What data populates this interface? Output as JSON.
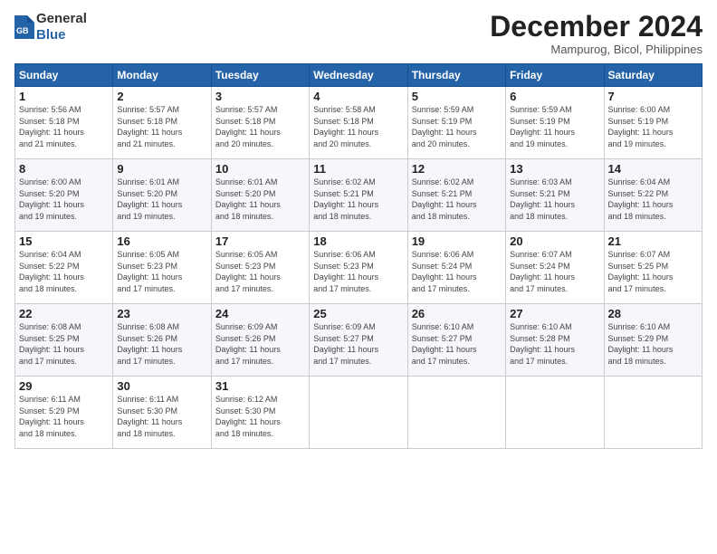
{
  "header": {
    "logo": {
      "general": "General",
      "blue": "Blue"
    },
    "title": "December 2024",
    "location": "Mampurog, Bicol, Philippines"
  },
  "calendar": {
    "days_of_week": [
      "Sunday",
      "Monday",
      "Tuesday",
      "Wednesday",
      "Thursday",
      "Friday",
      "Saturday"
    ],
    "weeks": [
      [
        {
          "day": "1",
          "sunrise": "5:56 AM",
          "sunset": "5:18 PM",
          "daylight": "11 hours and 21 minutes."
        },
        {
          "day": "2",
          "sunrise": "5:57 AM",
          "sunset": "5:18 PM",
          "daylight": "11 hours and 21 minutes."
        },
        {
          "day": "3",
          "sunrise": "5:57 AM",
          "sunset": "5:18 PM",
          "daylight": "11 hours and 20 minutes."
        },
        {
          "day": "4",
          "sunrise": "5:58 AM",
          "sunset": "5:18 PM",
          "daylight": "11 hours and 20 minutes."
        },
        {
          "day": "5",
          "sunrise": "5:59 AM",
          "sunset": "5:19 PM",
          "daylight": "11 hours and 20 minutes."
        },
        {
          "day": "6",
          "sunrise": "5:59 AM",
          "sunset": "5:19 PM",
          "daylight": "11 hours and 19 minutes."
        },
        {
          "day": "7",
          "sunrise": "6:00 AM",
          "sunset": "5:19 PM",
          "daylight": "11 hours and 19 minutes."
        }
      ],
      [
        {
          "day": "8",
          "sunrise": "6:00 AM",
          "sunset": "5:20 PM",
          "daylight": "11 hours and 19 minutes."
        },
        {
          "day": "9",
          "sunrise": "6:01 AM",
          "sunset": "5:20 PM",
          "daylight": "11 hours and 19 minutes."
        },
        {
          "day": "10",
          "sunrise": "6:01 AM",
          "sunset": "5:20 PM",
          "daylight": "11 hours and 18 minutes."
        },
        {
          "day": "11",
          "sunrise": "6:02 AM",
          "sunset": "5:21 PM",
          "daylight": "11 hours and 18 minutes."
        },
        {
          "day": "12",
          "sunrise": "6:02 AM",
          "sunset": "5:21 PM",
          "daylight": "11 hours and 18 minutes."
        },
        {
          "day": "13",
          "sunrise": "6:03 AM",
          "sunset": "5:21 PM",
          "daylight": "11 hours and 18 minutes."
        },
        {
          "day": "14",
          "sunrise": "6:04 AM",
          "sunset": "5:22 PM",
          "daylight": "11 hours and 18 minutes."
        }
      ],
      [
        {
          "day": "15",
          "sunrise": "6:04 AM",
          "sunset": "5:22 PM",
          "daylight": "11 hours and 18 minutes."
        },
        {
          "day": "16",
          "sunrise": "6:05 AM",
          "sunset": "5:23 PM",
          "daylight": "11 hours and 17 minutes."
        },
        {
          "day": "17",
          "sunrise": "6:05 AM",
          "sunset": "5:23 PM",
          "daylight": "11 hours and 17 minutes."
        },
        {
          "day": "18",
          "sunrise": "6:06 AM",
          "sunset": "5:23 PM",
          "daylight": "11 hours and 17 minutes."
        },
        {
          "day": "19",
          "sunrise": "6:06 AM",
          "sunset": "5:24 PM",
          "daylight": "11 hours and 17 minutes."
        },
        {
          "day": "20",
          "sunrise": "6:07 AM",
          "sunset": "5:24 PM",
          "daylight": "11 hours and 17 minutes."
        },
        {
          "day": "21",
          "sunrise": "6:07 AM",
          "sunset": "5:25 PM",
          "daylight": "11 hours and 17 minutes."
        }
      ],
      [
        {
          "day": "22",
          "sunrise": "6:08 AM",
          "sunset": "5:25 PM",
          "daylight": "11 hours and 17 minutes."
        },
        {
          "day": "23",
          "sunrise": "6:08 AM",
          "sunset": "5:26 PM",
          "daylight": "11 hours and 17 minutes."
        },
        {
          "day": "24",
          "sunrise": "6:09 AM",
          "sunset": "5:26 PM",
          "daylight": "11 hours and 17 minutes."
        },
        {
          "day": "25",
          "sunrise": "6:09 AM",
          "sunset": "5:27 PM",
          "daylight": "11 hours and 17 minutes."
        },
        {
          "day": "26",
          "sunrise": "6:10 AM",
          "sunset": "5:27 PM",
          "daylight": "11 hours and 17 minutes."
        },
        {
          "day": "27",
          "sunrise": "6:10 AM",
          "sunset": "5:28 PM",
          "daylight": "11 hours and 17 minutes."
        },
        {
          "day": "28",
          "sunrise": "6:10 AM",
          "sunset": "5:29 PM",
          "daylight": "11 hours and 18 minutes."
        }
      ],
      [
        {
          "day": "29",
          "sunrise": "6:11 AM",
          "sunset": "5:29 PM",
          "daylight": "11 hours and 18 minutes."
        },
        {
          "day": "30",
          "sunrise": "6:11 AM",
          "sunset": "5:30 PM",
          "daylight": "11 hours and 18 minutes."
        },
        {
          "day": "31",
          "sunrise": "6:12 AM",
          "sunset": "5:30 PM",
          "daylight": "11 hours and 18 minutes."
        },
        null,
        null,
        null,
        null
      ]
    ]
  }
}
